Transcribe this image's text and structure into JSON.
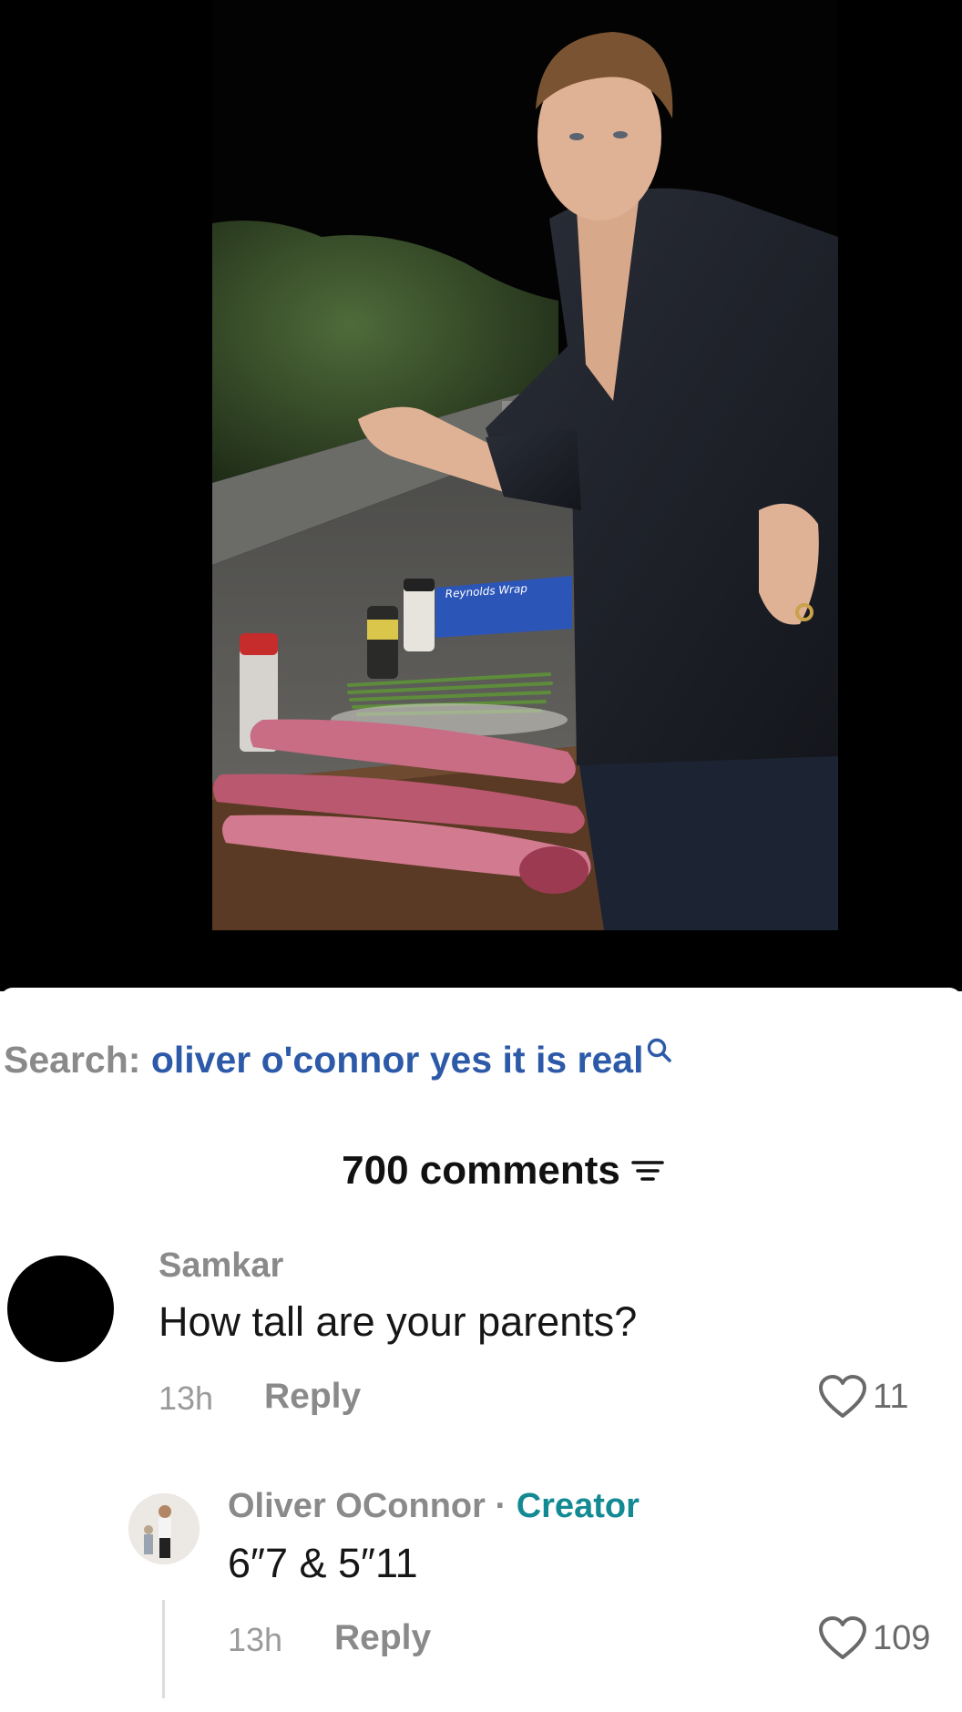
{
  "search": {
    "prefix": "Search:",
    "query": "oliver o'connor yes it is real"
  },
  "comments_header": {
    "count_label": "700 comments"
  },
  "comments": [
    {
      "username": "Samkar",
      "text": "How tall are your parents?",
      "time": "13h",
      "reply_label": "Reply",
      "likes": "11"
    },
    {
      "username": "Oliver OConnor",
      "separator": "·",
      "badge": "Creator",
      "text": "6″7 & 5″11",
      "time": "13h",
      "reply_label": "Reply",
      "likes": "109"
    }
  ],
  "colors": {
    "search_query": "#2d5aa8",
    "creator_badge": "#138a93",
    "muted_text": "#8a8a8a"
  }
}
